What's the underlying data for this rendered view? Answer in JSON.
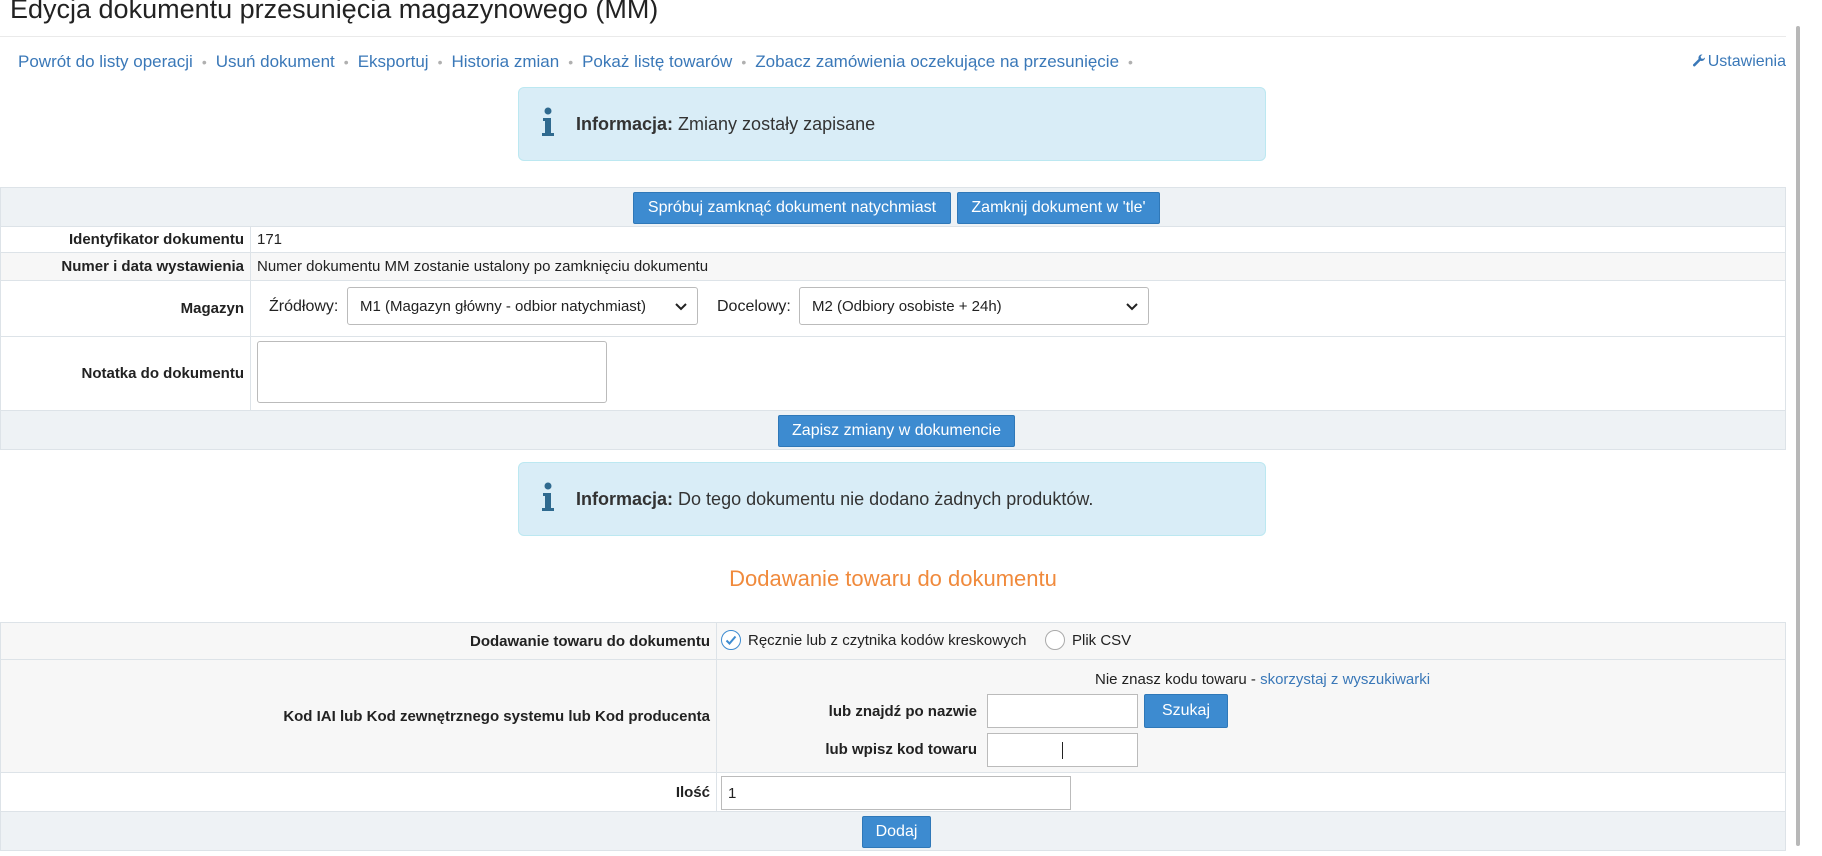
{
  "page": {
    "title": "Edycja dokumentu przesunięcia magazynowego (MM)"
  },
  "nav": {
    "links": [
      "Powrót do listy operacji",
      "Usuń dokument",
      "Eksportuj",
      "Historia zmian",
      "Pokaż listę towarów",
      "Zobacz zamówienia oczekujące na przesunięcie"
    ],
    "settings_label": "Ustawienia"
  },
  "info1": {
    "label": "Informacja:",
    "text": "Zmiany zostały zapisane"
  },
  "actions": {
    "close_now": "Spróbuj zamknąć dokument natychmiast",
    "close_background": "Zamknij dokument w 'tle'"
  },
  "doc": {
    "id_label": "Identyfikator dokumentu",
    "id_value": "171",
    "number_label": "Numer i data wystawienia",
    "number_value": "Numer dokumentu MM zostanie ustalony po zamknięciu dokumentu",
    "warehouse_label": "Magazyn",
    "source_label": "Źródłowy:",
    "source_value": "M1 (Magazyn główny - odbior natychmiast)",
    "target_label": "Docelowy:",
    "target_value": "M2 (Odbiory osobiste + 24h)",
    "note_label": "Notatka do dokumentu",
    "note_value": "",
    "save_button": "Zapisz zmiany w dokumencie"
  },
  "info2": {
    "label": "Informacja:",
    "text": "Do tego dokumentu nie dodano żadnych produktów."
  },
  "add": {
    "section_title": "Dodawanie towaru do dokumentu",
    "mode_label": "Dodawanie towaru do dokumentu",
    "mode_manual": "Ręcznie lub z czytnika kodów kreskowych",
    "mode_csv": "Plik CSV",
    "code_label": "Kod IAI lub Kod zewnętrznego systemu lub Kod producenta",
    "hint_text": "Nie znasz kodu towaru - ",
    "hint_link": "skorzystaj z wyszukiwarki",
    "by_name_label": "lub znajdź po nazwie",
    "search_button": "Szukaj",
    "by_code_label": "lub wpisz kod towaru",
    "qty_label": "Ilość",
    "qty_value": "1",
    "add_button": "Dodaj"
  },
  "colors": {
    "accent": "#3d8bd0",
    "link": "#3a78b8",
    "info_bg": "#d9edf7",
    "section_title": "#f08a3c"
  }
}
